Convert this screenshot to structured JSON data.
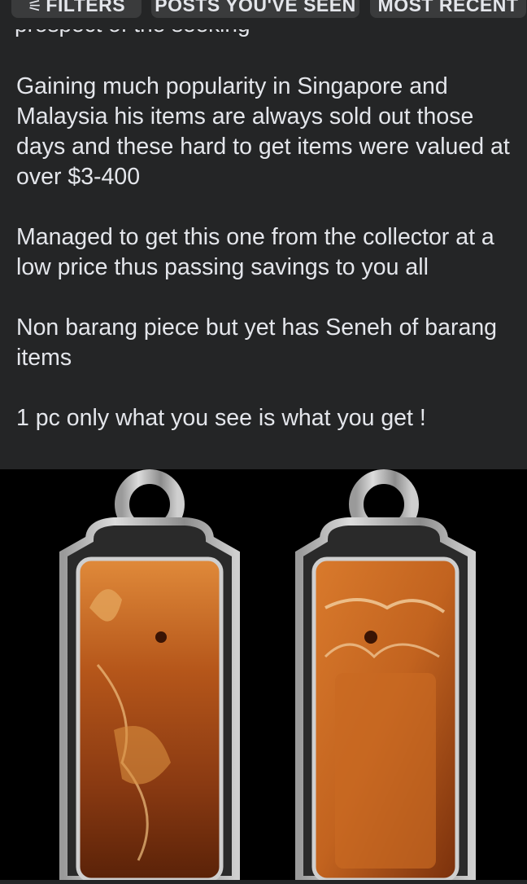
{
  "filters": [
    {
      "icon": "filter-icon",
      "label": "FILTERS"
    },
    {
      "label": "POSTS YOU'VE SEEN"
    },
    {
      "label": "MOST RECENT"
    }
  ],
  "post": {
    "cut_line": "prospect of the seeking",
    "paragraphs": [
      "Gaining much popularity in Singapore and Malaysia his items are always sold out those days and these hard to get items were valued at over $3-400",
      "Managed to get this one from the collector at a low price thus passing savings to you all",
      "Non barang piece but yet has Seneh of barang items",
      "1 pc only what you see is what you get !"
    ]
  },
  "colors": {
    "background": "#242526",
    "chip": "#3a3b3c",
    "text": "#e4e6eb",
    "amber": "#b5561a"
  }
}
